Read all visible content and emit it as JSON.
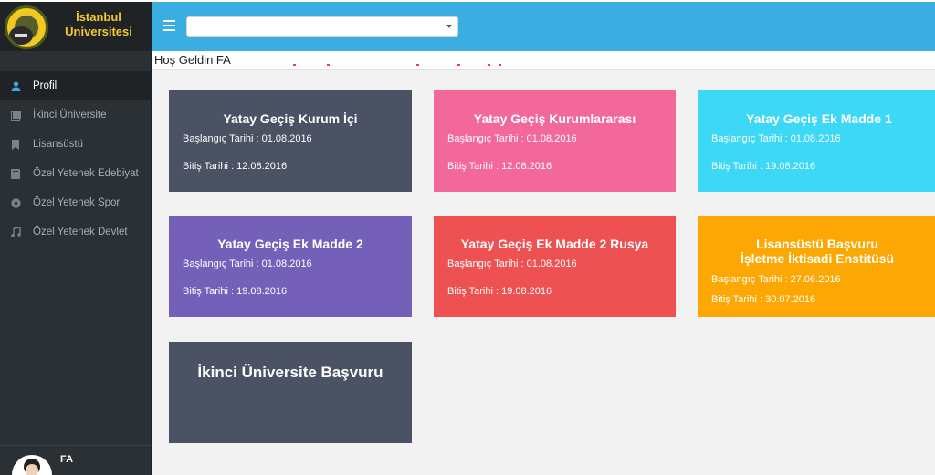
{
  "brand": {
    "line1": "İstanbul",
    "line2": "Üniversitesi"
  },
  "sidebar": {
    "items": [
      {
        "label": "Profil",
        "icon": "user-icon"
      },
      {
        "label": "İkinci Üniversite",
        "icon": "document-icon"
      },
      {
        "label": "Lisansüstü",
        "icon": "bookmark-icon"
      },
      {
        "label": "Özel Yetenek Edebiyat",
        "icon": "book-icon"
      },
      {
        "label": "Özel Yetenek Spor",
        "icon": "soccer-ball-icon"
      },
      {
        "label": "Özel Yetenek Devlet",
        "icon": "music-note-icon"
      }
    ],
    "user_name": "FA"
  },
  "header": {
    "select_value": ""
  },
  "welcome": "Hoş Geldin FA",
  "cards": [
    {
      "title": "Yatay Geçiş Kurum İçi",
      "start": "Başlangıç Tarihi : 01.08.2016",
      "end": "Bitiş Tarihi : 12.08.2016",
      "color": "#4b5263"
    },
    {
      "title": "Yatay Geçiş Kurumlararası",
      "start": "Başlangıç Tarihi : 01.08.2016",
      "end": "Bitiş Tarihi : 12.08.2016",
      "color": "#f3689a"
    },
    {
      "title": "Yatay Geçiş Ek Madde 1",
      "start": "Başlangıç Tarihi : 01.08.2016",
      "end": "Bitiş Tarihi : 19.08.2016",
      "color": "#3cd8f5"
    },
    {
      "title": "Yatay Geçiş Ek Madde 2",
      "start": "Başlangıç Tarihi : 01.08.2016",
      "end": "Bitiş Tarihi : 19.08.2016",
      "color": "#7460b9"
    },
    {
      "title": "Yatay Geçiş Ek Madde 2 Rusya",
      "start": "Başlangıç Tarihi : 01.08.2016",
      "end": "Bitiş Tarihi : 19.08.2016",
      "color": "#ee5152"
    },
    {
      "title_line1": "Lisansüstü Başvuru",
      "title_line2": "İşletme İktisadi Enstitüsü",
      "start": "Başlangıç Tarihi : 27.06.2016",
      "end": "Bitiş Tarihi : 30.07.2016",
      "color": "#fda704"
    },
    {
      "title": "İkinci Üniversite Başvuru",
      "color": "#4b5263"
    }
  ]
}
